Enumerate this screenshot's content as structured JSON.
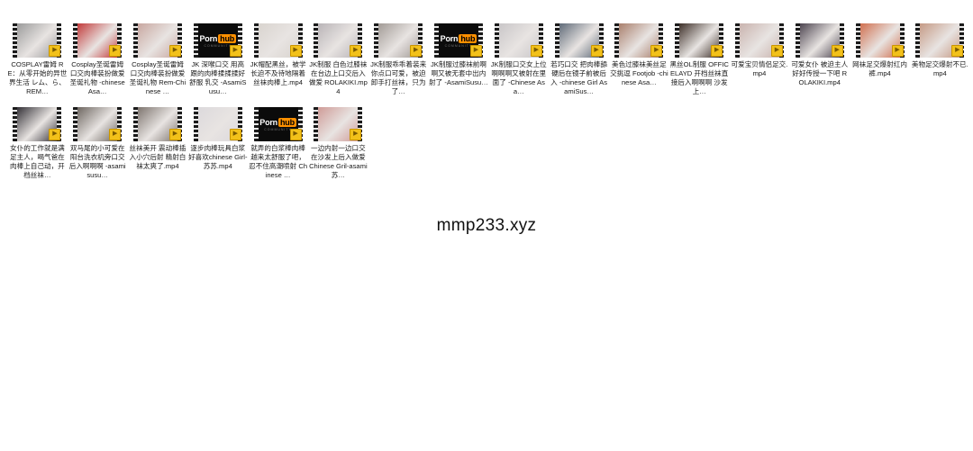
{
  "watermark": "mmp233.xyz",
  "files": [
    {
      "caption": "COSPLAY雷姆 RE：从零开始的异世界生活 レム、ら、REM…",
      "thumb": "photo",
      "color": "#9b9b9b"
    },
    {
      "caption": "Cosplay圣诞雷姆 口交肉棒装扮做爱 圣诞礼物 -chinese Asa…",
      "thumb": "photo",
      "color": "#c23a3a"
    },
    {
      "caption": "Cosplay圣诞雷姆 口交肉棒装扮做爱 圣诞礼物 Rem-Chinese …",
      "thumb": "photo",
      "color": "#c8a7a0"
    },
    {
      "caption": "JK 深喉口交 用高跟的肉棒揉揉揉好舒服 乳交 -AsamiSusu…",
      "thumb": "pornhub",
      "color": "#0b0b0b"
    },
    {
      "caption": "JK帽配黑丝，被学长迫不及待地隔着丝袜肉棒上.mp4",
      "thumb": "photo",
      "color": "#d9d4cf"
    },
    {
      "caption": "JK制服 白色过膝袜 在台边上口交后入做爱 ROLAKIKI.mp4",
      "thumb": "photo",
      "color": "#b9b4b7"
    },
    {
      "caption": "JK制服乖乖着装来你点口可爱，被迫卸手打丝袜，只为了…",
      "thumb": "photo",
      "color": "#a29b96"
    },
    {
      "caption": "JK制服过膝袜前啊啊又被无套中出内射了 -AsamiSusu…",
      "thumb": "pornhub",
      "color": "#0b0b0b"
    },
    {
      "caption": "JK制服口交女上位啊啊啊又被射在里面了 -Chinese Asa…",
      "thumb": "photo",
      "color": "#c9c6c8"
    },
    {
      "caption": "若巧口交 把肉棒舔硬后在镜子前被后入 -chinese Girl AsamiSus…",
      "thumb": "photo",
      "color": "#5f6a78"
    },
    {
      "caption": "美色过膝袜美丝足交挑逗 Footjob -chinese Asa…",
      "thumb": "photo",
      "color": "#a97f6c"
    },
    {
      "caption": "黑丝OL制服 OFFICELAYD 开档丝袜直接后入啊啊啊 沙发上…",
      "thumb": "photo",
      "color": "#3d2f28"
    },
    {
      "caption": "可爱宝贝情侣足交.mp4",
      "thumb": "photo",
      "color": "#c9b3ae"
    },
    {
      "caption": "可爱女仆 被迫主人好好传授一下吧 ROLAKIKI.mp4",
      "thumb": "photo",
      "color": "#4d4550"
    },
    {
      "caption": "网袜足交爆射红内裤.mp4",
      "thumb": "photo",
      "color": "#d06f4f"
    },
    {
      "caption": "美物足交爆射不已.mp4",
      "thumb": "photo",
      "color": "#c59a85"
    },
    {
      "caption": "女仆的工作就是满足主人，喝气爸在肉棒上自己动，开档丝袜…",
      "thumb": "photo",
      "color": "#333036"
    },
    {
      "caption": "双马尾的小可爱在阳台洗衣机旁口交后入啊啊啊 -asamisusu…",
      "thumb": "photo",
      "color": "#6d6660"
    },
    {
      "caption": "丝袜美开 震动棒插入小穴后射 精射白袜太爽了.mp4",
      "thumb": "photo",
      "color": "#7d746e"
    },
    {
      "caption": "逐步肉棒玩具白浆好喜欢chinese Girl-苏苏.mp4",
      "thumb": "photo",
      "color": "#dcd9dc"
    },
    {
      "caption": "就弄的白浆棒肉棒越来太舒服了吧，忍不住高潮喷射 Chinese …",
      "thumb": "pornhub",
      "color": "#0b0b0b"
    },
    {
      "caption": "一边内射一边口交 在沙发上后入做爱 Chinese Gril-asami苏…",
      "thumb": "photo",
      "color": "#cf9b97"
    }
  ],
  "pornhub_logo": {
    "left": "Porn",
    "right": "hub",
    "sub": "COMMUNITY"
  },
  "badge_icon": "file-type-badge-icon"
}
